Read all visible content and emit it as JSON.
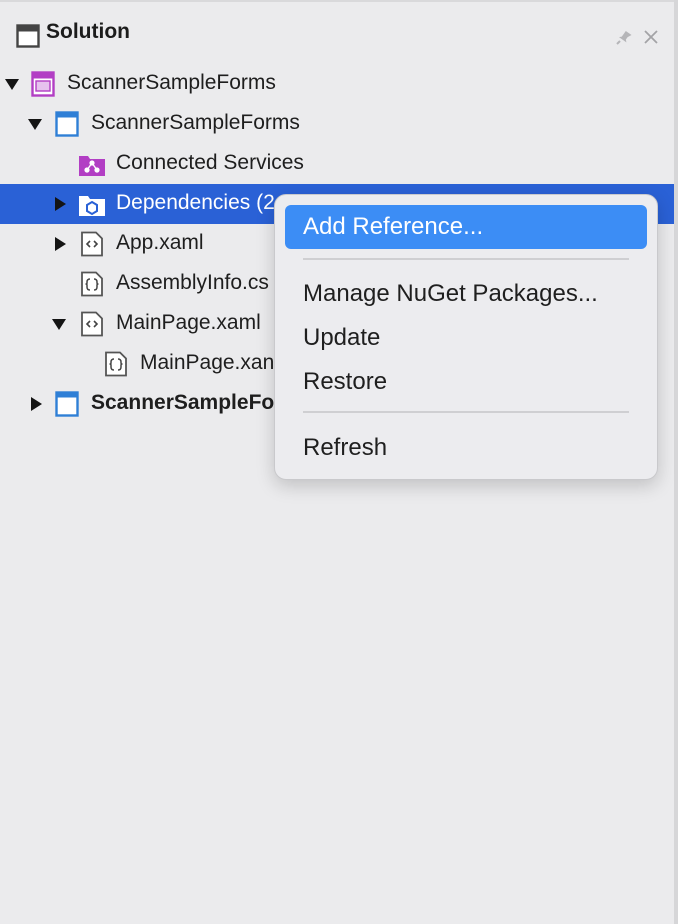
{
  "panel": {
    "title": "Solution",
    "header_icons": [
      "panel-icon",
      "pin-icon",
      "close-icon"
    ]
  },
  "tree": {
    "items": [
      {
        "label": "ScannerSampleForms",
        "icon": "solution-icon",
        "expanded": true
      },
      {
        "label": "ScannerSampleForms",
        "icon": "project-icon",
        "expanded": true
      },
      {
        "label": "Connected Services",
        "icon": "connected-services-icon"
      },
      {
        "label": "Dependencies (2",
        "icon": "dependencies-icon",
        "expanded": false,
        "selected": true
      },
      {
        "label": "App.xaml",
        "icon": "xaml-file-icon",
        "expanded": false
      },
      {
        "label": "AssemblyInfo.cs",
        "icon": "cs-file-icon"
      },
      {
        "label": "MainPage.xaml",
        "icon": "xaml-file-icon",
        "expanded": true
      },
      {
        "label": "MainPage.xan",
        "icon": "cs-file-icon"
      },
      {
        "label": "ScannerSampleFo",
        "icon": "project-icon",
        "expanded": false,
        "bold": true
      }
    ]
  },
  "context_menu": {
    "items": [
      {
        "label": "Add Reference...",
        "highlighted": true
      },
      {
        "label": "Manage NuGet Packages..."
      },
      {
        "label": "Update"
      },
      {
        "label": "Restore"
      },
      {
        "label": "Refresh"
      }
    ]
  },
  "colors": {
    "selection": "#2a61d6",
    "menu_highlight": "#3c8df5",
    "solution_accent": "#b23ec4",
    "project_accent": "#2f7fd6"
  }
}
